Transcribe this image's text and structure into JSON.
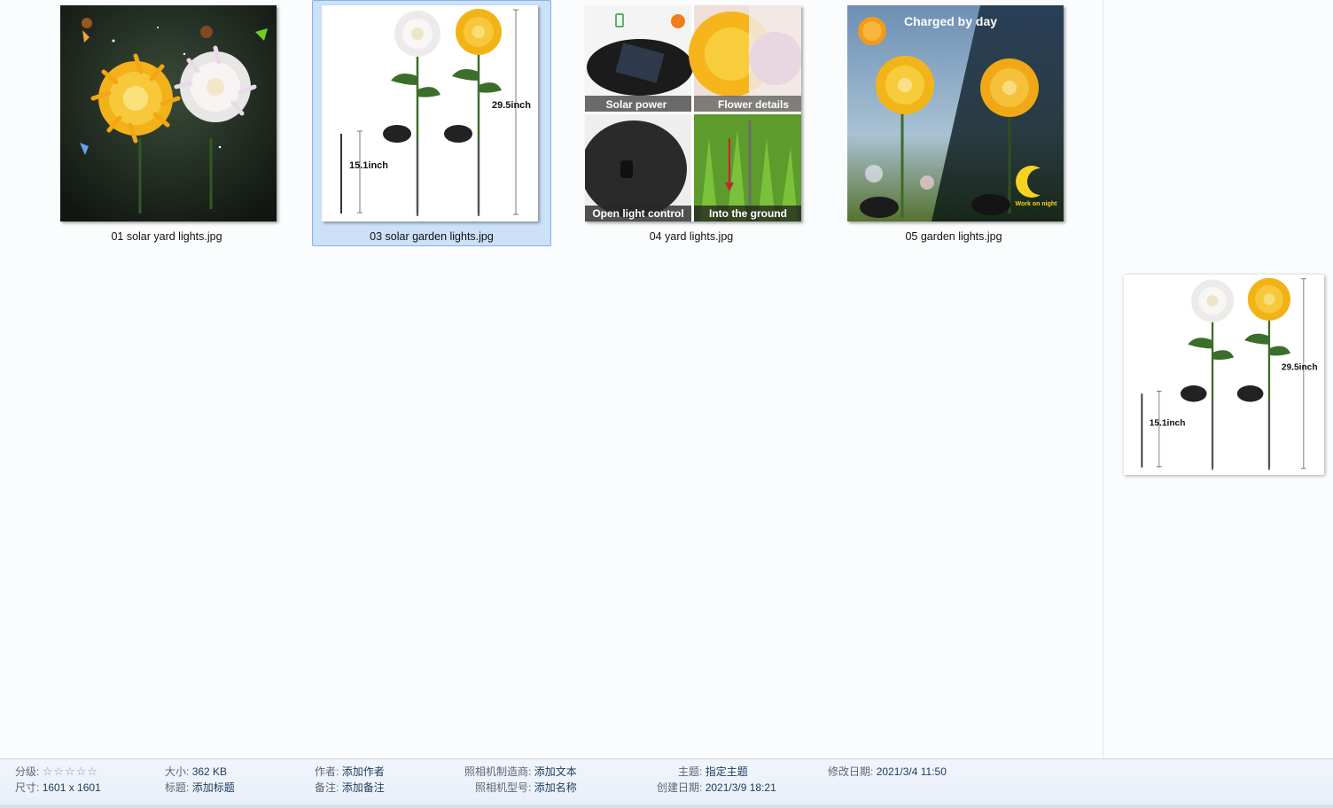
{
  "files": [
    {
      "name": "01 solar yard lights.jpg",
      "selected": false
    },
    {
      "name": "03 solar garden lights.jpg",
      "selected": true,
      "measure_long": "29.5inch",
      "measure_short": "15.1inch"
    },
    {
      "name": "04 yard lights.jpg",
      "selected": false,
      "panels": [
        "Solar power",
        "Flower details",
        "Open light control",
        "Into the ground"
      ]
    },
    {
      "name": "05 garden lights.jpg",
      "selected": false,
      "headline": "Charged by day",
      "night_label": "Work on night"
    }
  ],
  "preview": {
    "measure_long": "29.5inch",
    "measure_short": "15.1inch"
  },
  "details": {
    "rating": {
      "label": "分级:",
      "stars": "☆☆☆☆☆"
    },
    "dimensions": {
      "label": "尺寸:",
      "value": "1601 x 1601"
    },
    "size": {
      "label": "大小:",
      "value": "362 KB"
    },
    "title": {
      "label": "标题:",
      "value": "添加标题"
    },
    "author": {
      "label": "作者:",
      "value": "添加作者"
    },
    "comments": {
      "label": "备注:",
      "value": "添加备注"
    },
    "camera_maker": {
      "label": "照相机制造商:",
      "value": "添加文本"
    },
    "camera_model": {
      "label": "照相机型号:",
      "value": "添加名称"
    },
    "subject": {
      "label": "主题:",
      "value": "指定主题"
    },
    "date_created": {
      "label": "创建日期:",
      "value": "2021/3/9 18:21"
    },
    "date_modified": {
      "label": "修改日期:",
      "value": "2021/3/4 11:50"
    }
  }
}
